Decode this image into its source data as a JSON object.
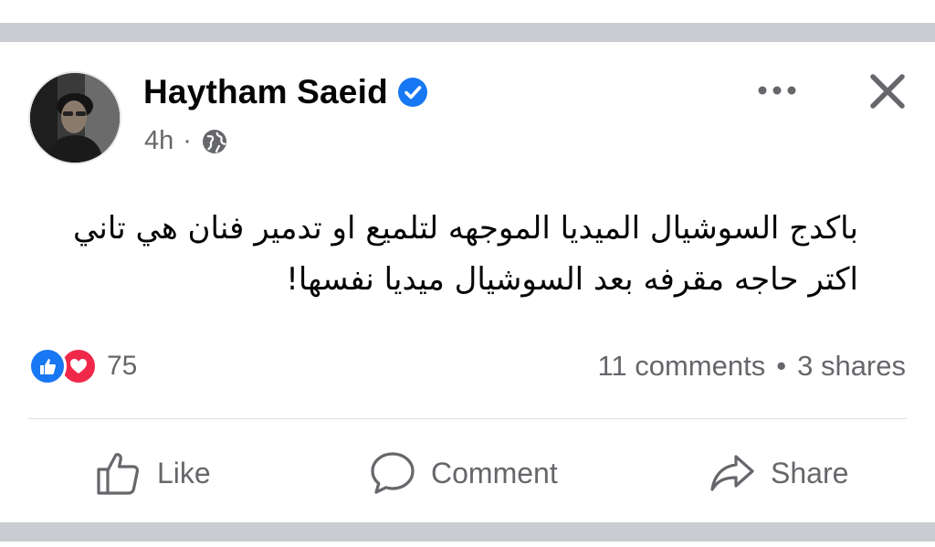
{
  "post": {
    "author": "Haytham Saeid",
    "time": "4h",
    "separator": "·",
    "visibility_icon": "globe-icon",
    "verified_icon": "verified-badge-icon",
    "more_icon": "more-horizontal-icon",
    "close_icon": "close-icon",
    "text_lines": [
      "باكدج السوشيال الميديا الموجهه لتلميع او تدمير فنان هي تاني",
      "اكتر حاجه مقرفه بعد السوشيال ميديا نفسها!"
    ]
  },
  "engagement": {
    "reaction_icons": [
      "like-reaction-icon",
      "love-reaction-icon"
    ],
    "reaction_count": "75",
    "comments": "11 comments",
    "dot": "•",
    "shares": "3 shares"
  },
  "actions": {
    "like": "Like",
    "comment": "Comment",
    "share": "Share"
  },
  "colors": {
    "brand_blue": "#1877f2",
    "love_red": "#f02849",
    "secondary_text": "#65676b",
    "separator_band": "#c9ccd1"
  }
}
